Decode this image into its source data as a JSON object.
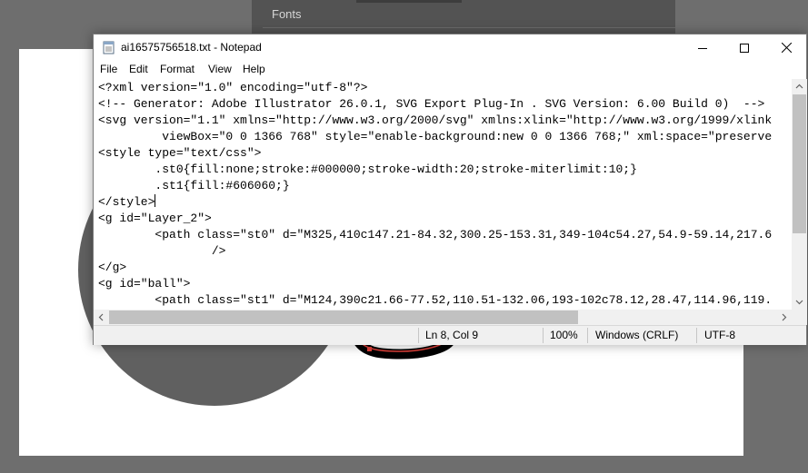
{
  "background_app": {
    "panel_label": "Fonts"
  },
  "notepad": {
    "title": "ai16575756518.txt - Notepad",
    "window_buttons": {
      "minimize": "minimize-icon",
      "maximize": "maximize-icon",
      "close": "close-icon"
    },
    "menu": [
      "File",
      "Edit",
      "Format",
      "View",
      "Help"
    ],
    "lines": [
      "<?xml version=\"1.0\" encoding=\"utf-8\"?>",
      "<!-- Generator: Adobe Illustrator 26.0.1, SVG Export Plug-In . SVG Version: 6.00 Build 0)  -->",
      "<svg version=\"1.1\" xmlns=\"http://www.w3.org/2000/svg\" xmlns:xlink=\"http://www.w3.org/1999/xlink",
      "\t viewBox=\"0 0 1366 768\" style=\"enable-background:new 0 0 1366 768;\" xml:space=\"preserve",
      "<style type=\"text/css\">",
      "\t.st0{fill:none;stroke:#000000;stroke-width:20;stroke-miterlimit:10;}",
      "\t.st1{fill:#606060;}",
      "</style>",
      "<g id=\"Layer_2\">",
      "\t<path class=\"st0\" d=\"M325,410c147.21-84.32,300.25-153.31,349-104c54.27,54.9-59.14,217.6",
      "\t\t/>",
      "</g>",
      "<g id=\"ball\">",
      "\t<path class=\"st1\" d=\"M124,390c21.66-77.52,110.51-132.06,193-102c78.12,28.47,114.96,119."
    ],
    "status": {
      "position": "Ln 8, Col 9",
      "zoom": "100%",
      "line_endings": "Windows (CRLF)",
      "encoding": "UTF-8"
    }
  }
}
